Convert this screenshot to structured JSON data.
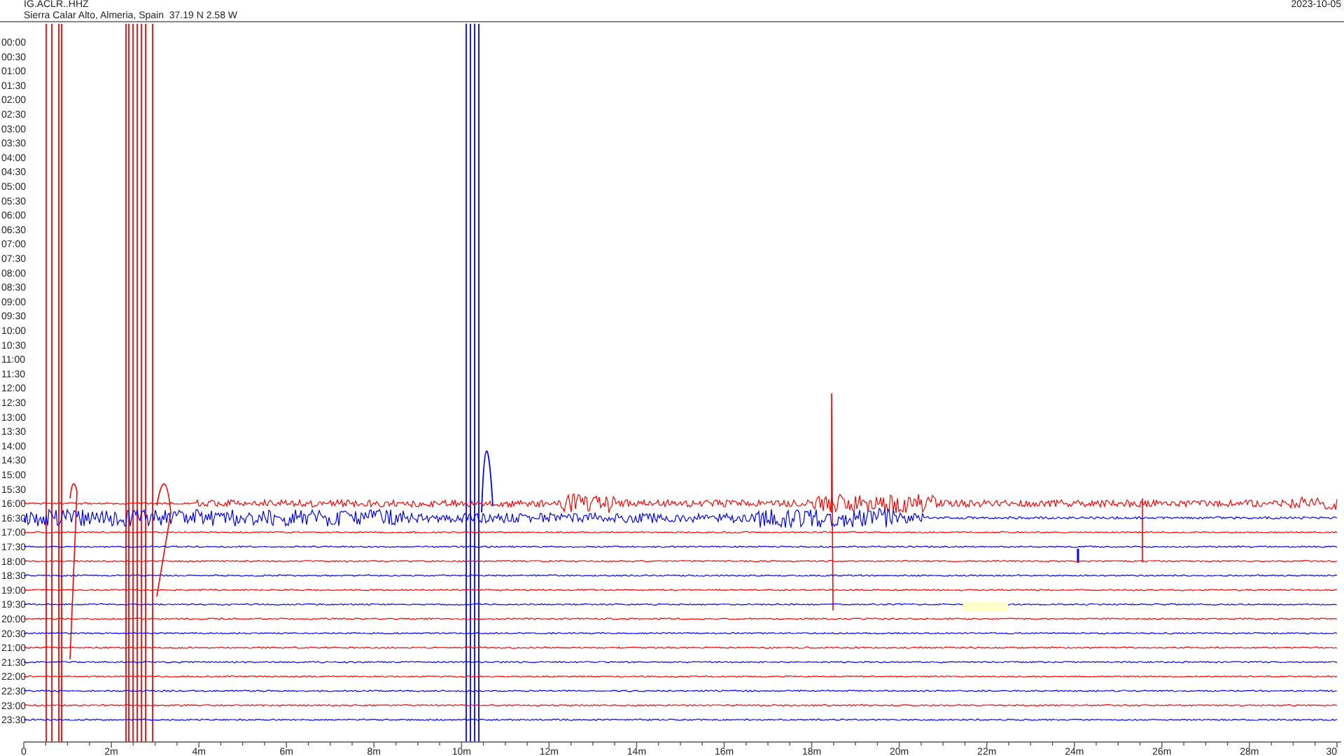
{
  "header": {
    "station": "IG.ACLR..HHZ",
    "location": "Sierra Calar Alto, Almeria, Spain  37.19 N 2.58 W",
    "date": "2023-10-05"
  },
  "rows": [
    {
      "label": "00:00"
    },
    {
      "label": "00:30"
    },
    {
      "label": "01:00"
    },
    {
      "label": "01:30"
    },
    {
      "label": "02:00"
    },
    {
      "label": "02:30"
    },
    {
      "label": "03:00"
    },
    {
      "label": "03:30"
    },
    {
      "label": "04:00"
    },
    {
      "label": "04:30"
    },
    {
      "label": "05:00"
    },
    {
      "label": "05:30"
    },
    {
      "label": "06:00"
    },
    {
      "label": "06:30"
    },
    {
      "label": "07:00"
    },
    {
      "label": "07:30"
    },
    {
      "label": "08:00"
    },
    {
      "label": "08:30"
    },
    {
      "label": "09:00"
    },
    {
      "label": "09:30"
    },
    {
      "label": "10:00"
    },
    {
      "label": "10:30"
    },
    {
      "label": "11:00"
    },
    {
      "label": "11:30"
    },
    {
      "label": "12:00"
    },
    {
      "label": "12:30"
    },
    {
      "label": "13:00"
    },
    {
      "label": "13:30"
    },
    {
      "label": "14:00"
    },
    {
      "label": "14:30"
    },
    {
      "label": "15:00"
    },
    {
      "label": "15:30"
    },
    {
      "label": "16:00",
      "color": "#ff0000"
    },
    {
      "label": "16:30",
      "color": "#0000ff"
    },
    {
      "label": "17:00",
      "color": "#ff0000"
    },
    {
      "label": "17:30",
      "color": "#0000ff"
    },
    {
      "label": "18:00",
      "color": "#ff0000"
    },
    {
      "label": "18:30",
      "color": "#0000ff"
    },
    {
      "label": "19:00",
      "color": "#ff0000"
    },
    {
      "label": "19:30",
      "color": "#0000ff"
    },
    {
      "label": "20:00",
      "color": "#ff0000"
    },
    {
      "label": "20:30",
      "color": "#0000ff"
    },
    {
      "label": "21:00",
      "color": "#ff0000"
    },
    {
      "label": "21:30",
      "color": "#0000ff"
    },
    {
      "label": "22:00",
      "color": "#ff0000"
    },
    {
      "label": "22:30",
      "color": "#0000ff"
    },
    {
      "label": "23:00",
      "color": "#ff0000"
    },
    {
      "label": "23:30",
      "color": "#0000ff"
    }
  ],
  "x_axis": {
    "ticks": [
      "0",
      "2m",
      "4m",
      "6m",
      "8m",
      "10m",
      "12m",
      "14m",
      "16m",
      "18m",
      "20m",
      "22m",
      "24m",
      "26m",
      "28m",
      "30"
    ]
  }
}
